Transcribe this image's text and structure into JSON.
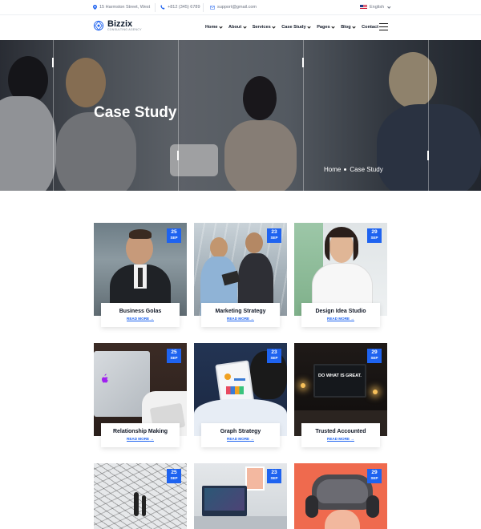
{
  "topbar": {
    "address": "15 Harmston Street, West",
    "phone": "+812 (345) 6789",
    "email": "support@gmail.com",
    "language": "English"
  },
  "header": {
    "logo_name": "Bizzix",
    "logo_tagline": "CONSULTING AGENCY",
    "nav": [
      "Home",
      "About",
      "Services",
      "Case Study",
      "Pages",
      "Blog",
      "Contact"
    ]
  },
  "hero": {
    "title": "Case Study",
    "breadcrumb": [
      "Home",
      "Case Study"
    ]
  },
  "cards": [
    {
      "day": "25",
      "month": "SEP",
      "title": "Business Golas",
      "link": "READ MORE"
    },
    {
      "day": "23",
      "month": "SEP",
      "title": "Marketing Strategy",
      "link": "READ MORE"
    },
    {
      "day": "29",
      "month": "SEP",
      "title": "Design Idea Studio",
      "link": "READ MORE"
    },
    {
      "day": "25",
      "month": "SEP",
      "title": "Relationship Making",
      "link": "READ MORE"
    },
    {
      "day": "23",
      "month": "SEP",
      "title": "Graph Strategy",
      "link": "READ MORE"
    },
    {
      "day": "29",
      "month": "SEP",
      "title": "Trusted Accounted",
      "link": "READ MORE"
    },
    {
      "day": "25",
      "month": "SEP",
      "title": "",
      "link": ""
    },
    {
      "day": "23",
      "month": "SEP",
      "title": "",
      "link": ""
    },
    {
      "day": "29",
      "month": "SEP",
      "title": "",
      "link": ""
    }
  ],
  "card_images": {
    "laptop_screen_text": "DO WHAT IS GREAT."
  },
  "colors": {
    "accent": "#1e63f0",
    "text_dark": "#111827"
  }
}
